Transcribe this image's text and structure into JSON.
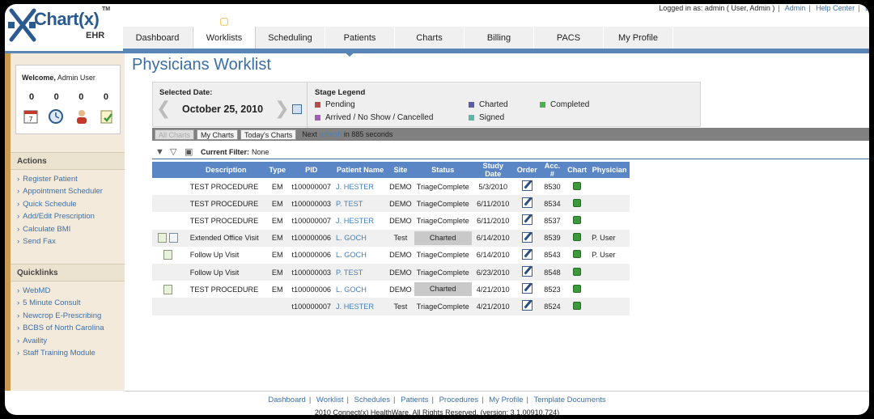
{
  "app": {
    "logo_text": "Chart(x)",
    "logo_sub": "EHR",
    "tm": "TM"
  },
  "toplinks": {
    "logged_in": "Logged in as: admin ( User, Admin )",
    "admin": "Admin",
    "help": "Help Center",
    "last": "L"
  },
  "tabs": [
    {
      "label": "Dashboard"
    },
    {
      "label": "Worklists"
    },
    {
      "label": "Scheduling"
    },
    {
      "label": "Patients"
    },
    {
      "label": "Charts"
    },
    {
      "label": "Billing"
    },
    {
      "label": "PACS"
    },
    {
      "label": "My Profile"
    }
  ],
  "welcome": {
    "prefix": "Welcome,",
    "name": "Admin User",
    "counts": [
      "0",
      "0",
      "0",
      "0"
    ]
  },
  "actions": {
    "title": "Actions",
    "items": [
      "Register Patient",
      "Appointment Scheduler",
      "Quick Schedule",
      "Add/Edit Prescription",
      "Calculate BMI",
      "Send Fax"
    ]
  },
  "quicklinks": {
    "title": "Quicklinks",
    "items": [
      "WebMD",
      "5 Minute Consult",
      "Newcrop E-Prescribing",
      "BCBS of North Carolina",
      "Availity",
      "Staff Training Module"
    ]
  },
  "page_title": "Physicians Worklist",
  "selected_date": {
    "label": "Selected Date:",
    "value": "October 25, 2010"
  },
  "legend": {
    "title": "Stage Legend",
    "items": [
      {
        "label": "Pending",
        "color": "#b94a48"
      },
      {
        "label": "Arrived / No Show / Cancelled",
        "color": "#a05fb5"
      },
      {
        "label": "Charted",
        "color": "#5b5ea6"
      },
      {
        "label": "Signed",
        "color": "#5fb5a5"
      },
      {
        "label": "Completed",
        "color": "#4caf50"
      }
    ]
  },
  "filters": {
    "all": "All Charts",
    "my": "My Charts",
    "today": "Today's Charts",
    "next_prefix": "Next",
    "refresh": "refresh",
    "next_suffix": "in 885 seconds"
  },
  "current_filter": {
    "label": "Current Filter:",
    "value": "None"
  },
  "table": {
    "headers": [
      "Description",
      "Type",
      "PID",
      "Patient Name",
      "Site",
      "Status",
      "Study Date",
      "Order",
      "Acc. #",
      "Chart",
      "Physician"
    ],
    "rows": [
      {
        "icons": [],
        "desc": "TEST PROCEDURE",
        "type": "EM",
        "pid": "t100000007",
        "name": "J. HESTER",
        "site": "DEMO",
        "status": "TriageComplete",
        "charted": false,
        "date": "5/3/2010",
        "acc": "8530",
        "phys": ""
      },
      {
        "icons": [],
        "desc": "TEST PROCEDURE",
        "type": "EM",
        "pid": "t100000003",
        "name": "P. TEST",
        "site": "DEMO",
        "status": "TriageComplete",
        "charted": false,
        "date": "6/11/2010",
        "acc": "8534",
        "phys": ""
      },
      {
        "icons": [],
        "desc": "TEST PROCEDURE",
        "type": "EM",
        "pid": "t100000007",
        "name": "J. HESTER",
        "site": "DEMO",
        "status": "TriageComplete",
        "charted": false,
        "date": "6/11/2010",
        "acc": "8537",
        "phys": ""
      },
      {
        "icons": [
          "note",
          "doc"
        ],
        "desc": "Extended Office Visit",
        "type": "EM",
        "pid": "t100000006",
        "name": "L. GOCH",
        "site": "Test",
        "status": "Charted",
        "charted": true,
        "date": "6/14/2010",
        "acc": "8539",
        "phys": "P. User"
      },
      {
        "icons": [
          "note"
        ],
        "desc": "Follow Up Visit",
        "type": "EM",
        "pid": "t100000006",
        "name": "L. GOCH",
        "site": "DEMO",
        "status": "TriageComplete",
        "charted": false,
        "date": "6/14/2010",
        "acc": "8543",
        "phys": "P. User"
      },
      {
        "icons": [],
        "desc": "Follow Up Visit",
        "type": "EM",
        "pid": "t100000003",
        "name": "P. TEST",
        "site": "DEMO",
        "status": "TriageComplete",
        "charted": false,
        "date": "6/23/2010",
        "acc": "8548",
        "phys": ""
      },
      {
        "icons": [
          "note"
        ],
        "desc": "TEST PROCEDURE",
        "type": "EM",
        "pid": "t100000006",
        "name": "L. GOCH",
        "site": "DEMO",
        "status": "Charted",
        "charted": true,
        "date": "4/21/2010",
        "acc": "8523",
        "phys": ""
      },
      {
        "icons": [],
        "desc": "",
        "type": "",
        "pid": "t100000007",
        "name": "J. HESTER",
        "site": "Test",
        "status": "TriageComplete",
        "charted": false,
        "date": "4/21/2010",
        "acc": "8524",
        "phys": ""
      }
    ]
  },
  "footer": {
    "links": [
      "Dashboard",
      "Worklist",
      "Schedules",
      "Patients",
      "Procedures",
      "My Profile",
      "Template Documents"
    ],
    "copyright": "2010 Connect(x) HealthWare. All Rights Reserved. (version: 3.1.00910.724)"
  }
}
